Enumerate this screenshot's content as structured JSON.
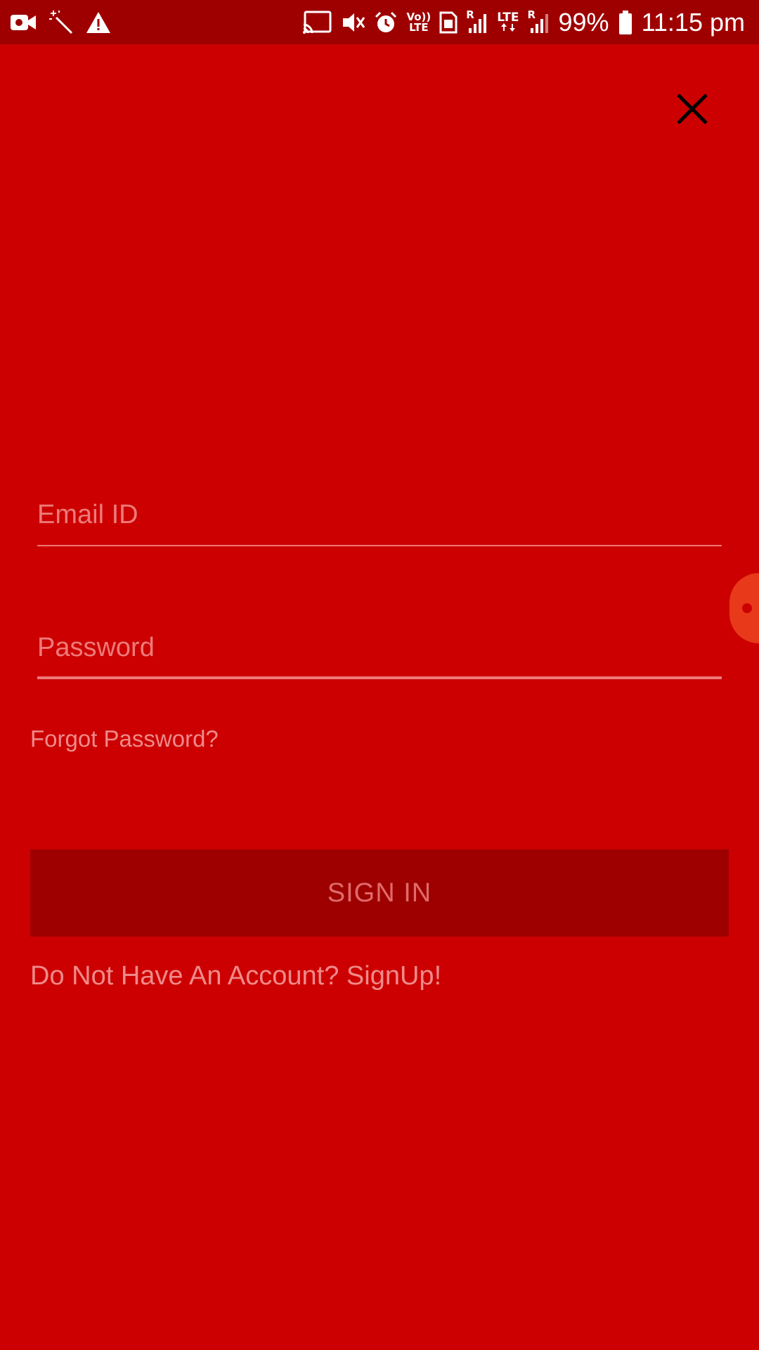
{
  "status_bar": {
    "left_icons": [
      "video-camera-icon",
      "magic-wand-icon",
      "warning-icon"
    ],
    "right_icons": [
      "cast-icon",
      "mute-icon",
      "alarm-icon",
      "volte-icon",
      "sim-icon",
      "signal-r-icon",
      "lte-icon",
      "signal-r2-icon",
      "battery-icon"
    ],
    "volte_label_top": "Vo))",
    "volte_label_bottom": "LTE",
    "lte_label": "LTE",
    "roaming_label": "R",
    "battery_percent": "99%",
    "time": "11:15 pm"
  },
  "colors": {
    "background": "#cc0000",
    "status_bar": "#9e0000",
    "button": "#9e0000",
    "muted_text": "#f08a8a"
  },
  "login": {
    "email_placeholder": "Email ID",
    "email_value": "",
    "password_placeholder": "Password",
    "password_value": "",
    "forgot_password": "Forgot Password?",
    "sign_in": "SIGN IN",
    "signup_prompt": "Do Not Have An Account? SignUp!"
  }
}
